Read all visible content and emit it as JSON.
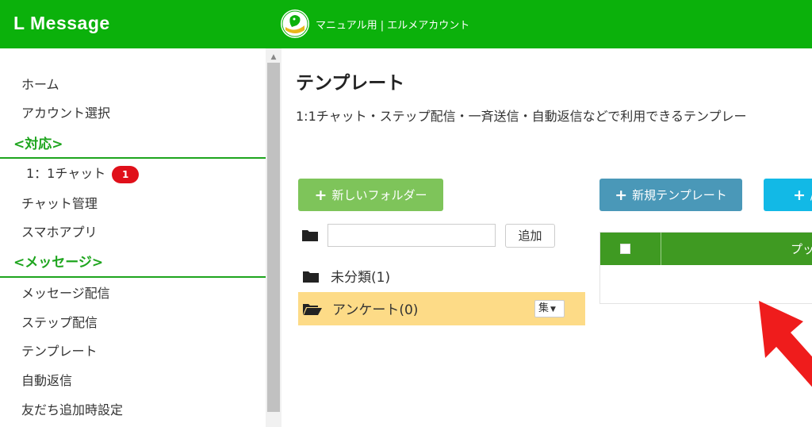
{
  "header": {
    "brand": "L Message",
    "account_name": "マニュアル用 | エルメアカウント",
    "colors": {
      "background": "#0bb10b"
    }
  },
  "sidebar": {
    "items": [
      {
        "label": "ホーム"
      },
      {
        "label": "アカウント選択"
      }
    ],
    "section_support": "<対応>",
    "support_items": [
      {
        "label": "1：1チャット",
        "badge": "1"
      },
      {
        "label": "チャット管理"
      },
      {
        "label": "スマホアプリ"
      }
    ],
    "section_message": "<メッセージ>",
    "message_items": [
      {
        "label": "メッセージ配信"
      },
      {
        "label": "ステップ配信"
      },
      {
        "label": "テンプレート"
      },
      {
        "label": "自動返信"
      },
      {
        "label": "友だち追加時設定"
      }
    ]
  },
  "main": {
    "title": "テンプレート",
    "description": "1:1チャット・ステップ配信・一斉送信・自動返信などで利用できるテンプレー",
    "new_folder_label": "新しいフォルダー",
    "new_template_label": "新規テンプレート",
    "third_button_label": "/",
    "folder_input_value": "",
    "add_label": "追加",
    "folders": [
      {
        "name": "未分類(1)",
        "selected": false
      },
      {
        "name": "アンケート(0)",
        "selected": true,
        "edit_label": "集"
      }
    ],
    "table": {
      "column_label": "プッ"
    }
  },
  "icons": [
    "folder-icon",
    "folder-open-icon",
    "plus-icon",
    "checkbox-icon",
    "caret-down-icon",
    "scroll-up-icon",
    "red-arrow-icon"
  ]
}
